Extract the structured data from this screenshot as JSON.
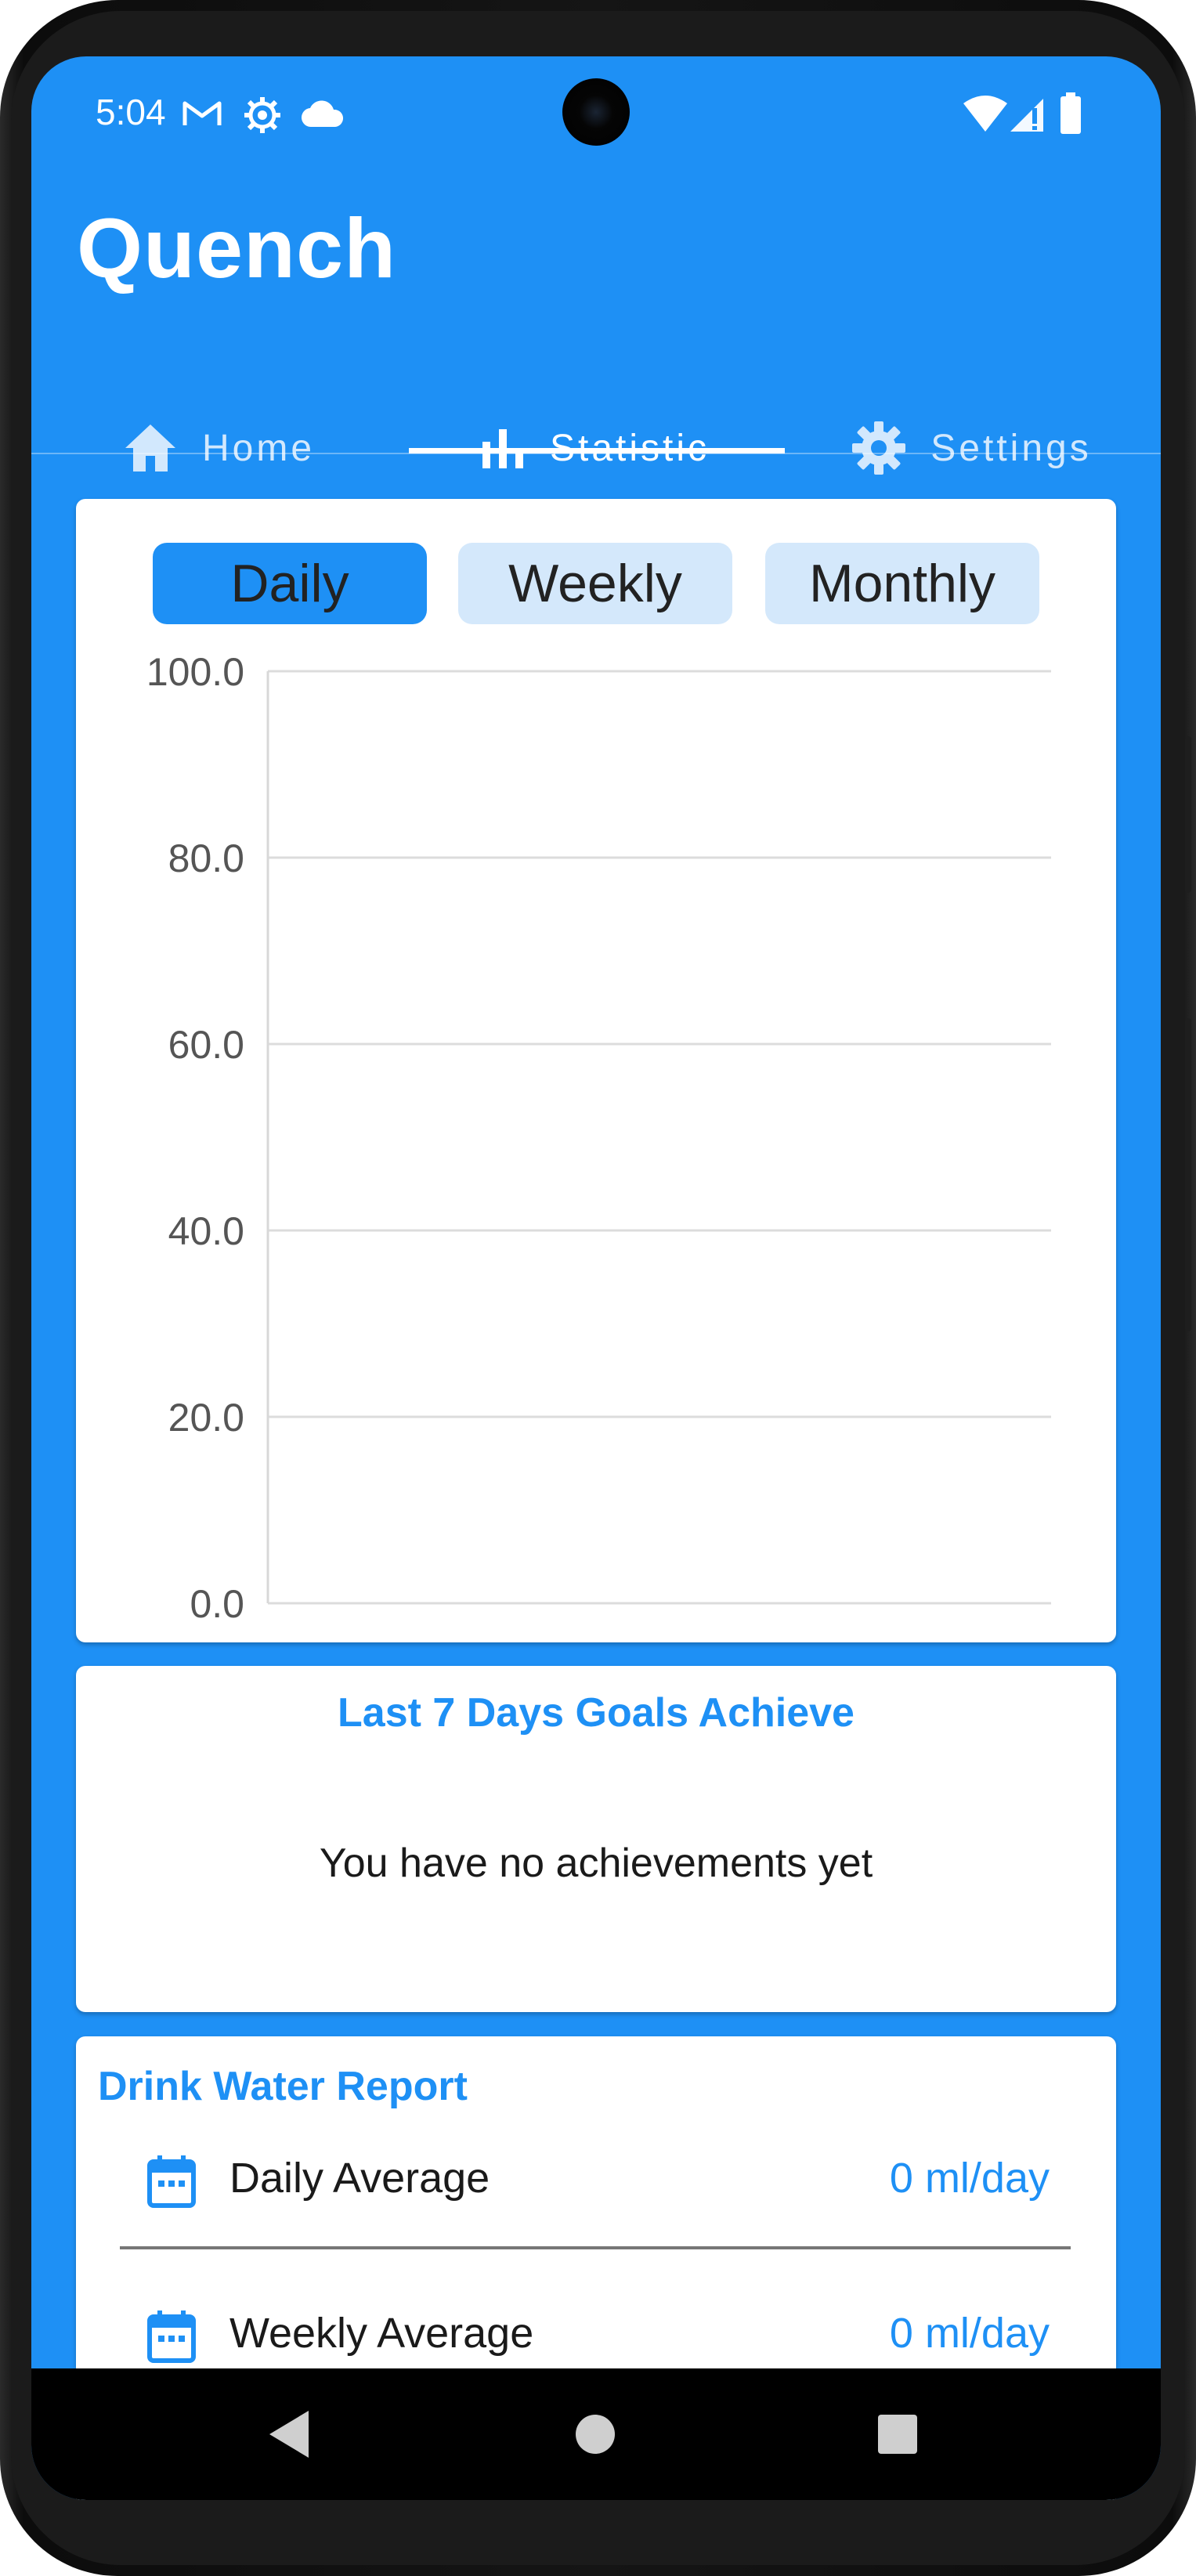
{
  "status_bar": {
    "time": "5:04",
    "icons": [
      "gmail-icon",
      "settings-gear-icon",
      "cloud-icon",
      "wifi-icon",
      "signal-icon",
      "battery-icon"
    ]
  },
  "app": {
    "title": "Quench",
    "primary_color": "#1E90F5",
    "tab_inactive_bg": "#D4E8FB"
  },
  "tabs": [
    {
      "label": "Home",
      "icon": "home-icon",
      "active": false
    },
    {
      "label": "Statistic",
      "icon": "bar-chart-icon",
      "active": true
    },
    {
      "label": "Settings",
      "icon": "gear-icon",
      "active": false
    }
  ],
  "period_selector": {
    "options": [
      "Daily",
      "Weekly",
      "Monthly"
    ],
    "selected": "Daily"
  },
  "chart_data": {
    "type": "bar",
    "title": "",
    "xlabel": "",
    "ylabel": "",
    "ylim": [
      0,
      100
    ],
    "yticks": [
      "100.0",
      "80.0",
      "60.0",
      "40.0",
      "20.0",
      "0.0"
    ],
    "categories": [],
    "values": [],
    "grid": true
  },
  "goals": {
    "title": "Last 7 Days Goals Achieve",
    "empty_message": "You have no achievements yet"
  },
  "report": {
    "title": "Drink Water Report",
    "rows": [
      {
        "icon": "calendar-icon",
        "label": "Daily Average",
        "value": "0 ml/day"
      },
      {
        "icon": "calendar-icon",
        "label": "Weekly Average",
        "value": "0 ml/day"
      }
    ]
  },
  "nav_bar": {
    "buttons": [
      "back-icon",
      "home-circle-icon",
      "recents-icon"
    ]
  }
}
